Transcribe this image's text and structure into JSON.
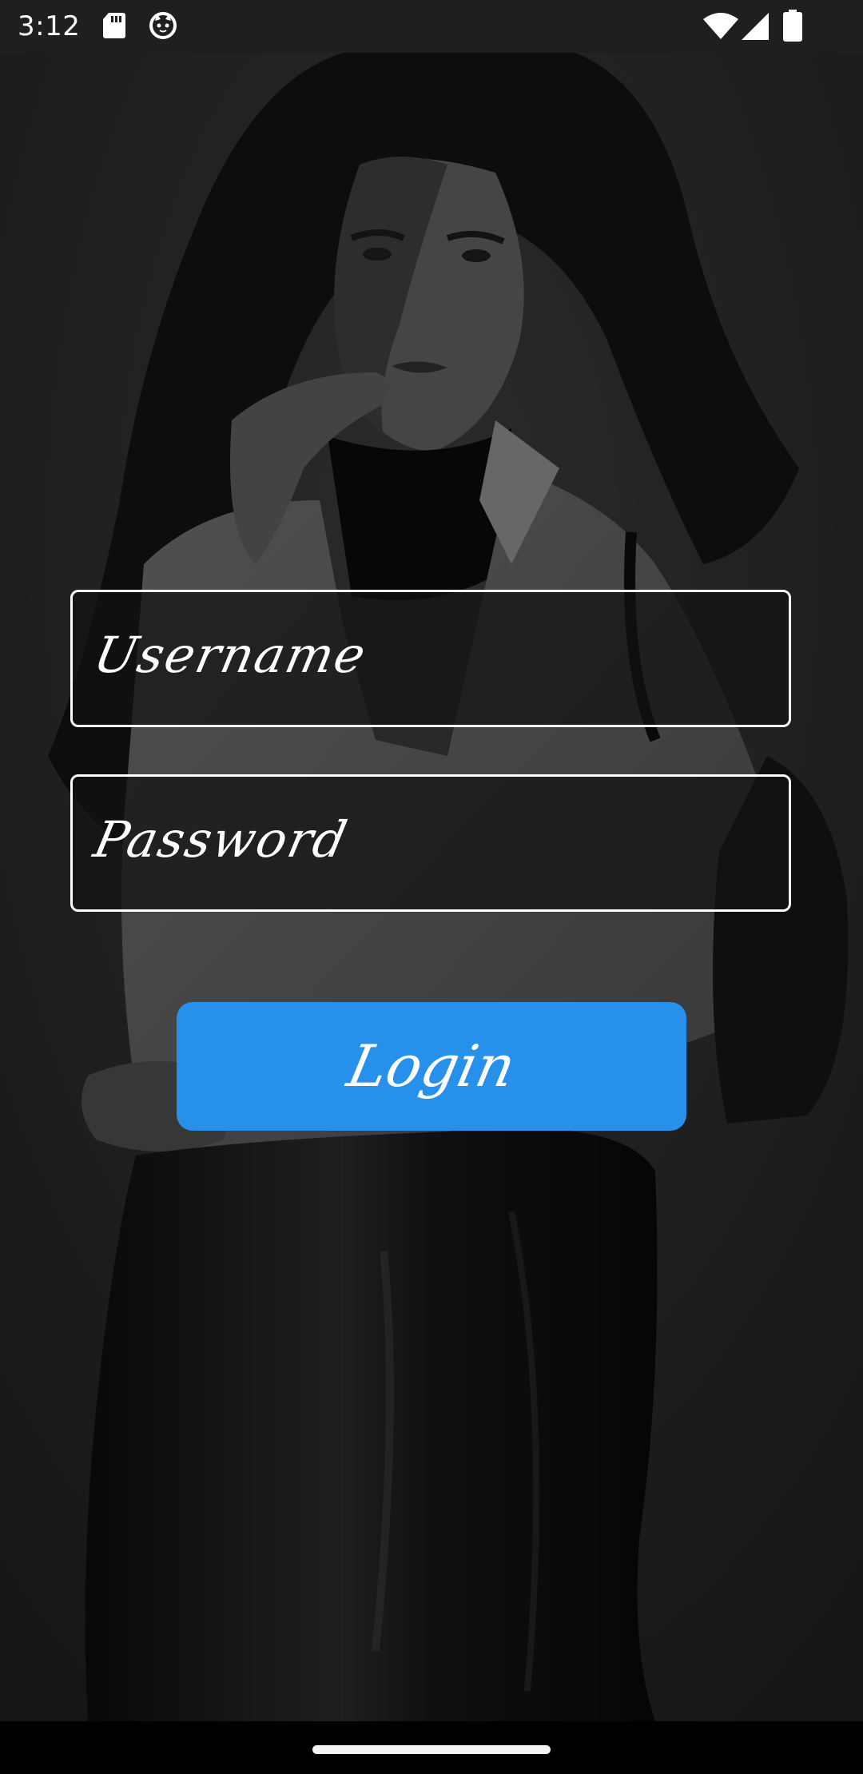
{
  "status_bar": {
    "time": "3:12",
    "icons": [
      "sd-card-icon",
      "cat-face-icon",
      "wifi-icon",
      "cellular-signal-icon",
      "battery-icon"
    ]
  },
  "background": {
    "image": "woman-photo-background",
    "tint": "#202020"
  },
  "form": {
    "username_placeholder": "Username",
    "password_placeholder": "Password",
    "login_label": "Login",
    "accent_color": "#2690ea"
  }
}
